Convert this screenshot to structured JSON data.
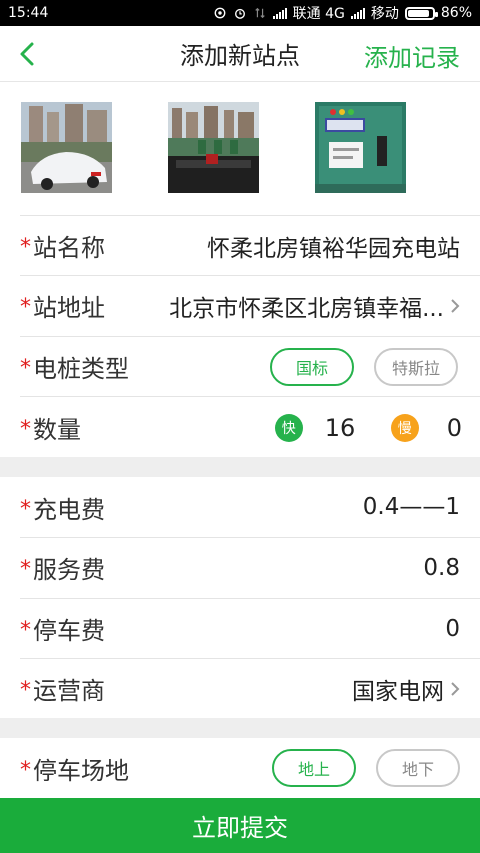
{
  "statusbar": {
    "time": "15:44",
    "carrier1": "联通 4G",
    "carrier2": "移动",
    "battery": "86%",
    "battery_level": 0.86
  },
  "header": {
    "title": "添加新站点",
    "action": "添加记录"
  },
  "photos": [
    "photo-parking-lot",
    "photo-charging-stations",
    "photo-charger-panel"
  ],
  "form": {
    "required_mark": "*",
    "station_name": {
      "label": "站名称",
      "value": "怀柔北房镇裕华园充电站"
    },
    "station_address": {
      "label": "站地址",
      "value": "北京市怀柔区北房镇幸福..."
    },
    "pile_type": {
      "label": "电桩类型",
      "options": [
        "国标",
        "特斯拉"
      ],
      "selected": "国标"
    },
    "quantity": {
      "label": "数量",
      "fast_label": "快",
      "fast_count": "16",
      "slow_label": "慢",
      "slow_count": "0"
    },
    "charging_fee": {
      "label": "充电费",
      "value": "0.4——1"
    },
    "service_fee": {
      "label": "服务费",
      "value": "0.8"
    },
    "parking_fee": {
      "label": "停车费",
      "value": "0"
    },
    "operator": {
      "label": "运营商",
      "value": "国家电网"
    },
    "parking_location": {
      "label": "停车场地",
      "options": [
        "地上",
        "地下"
      ],
      "selected": "地上"
    }
  },
  "submit_label": "立即提交",
  "colors": {
    "accent": "#26b24c",
    "submit_bg": "#1aac3b",
    "required": "#e02020",
    "slow_badge": "#f7a21b"
  }
}
